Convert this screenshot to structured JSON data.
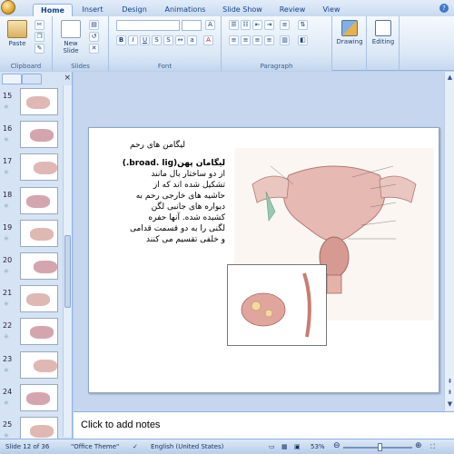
{
  "ribbon": {
    "tabs": [
      "Home",
      "Insert",
      "Design",
      "Animations",
      "Slide Show",
      "Review",
      "View"
    ],
    "active_tab": "Home",
    "groups": {
      "clipboard": {
        "label": "Clipboard",
        "paste": "Paste"
      },
      "slides": {
        "label": "Slides",
        "new_slide": "New Slide"
      },
      "font": {
        "label": "Font"
      },
      "paragraph": {
        "label": "Paragraph"
      },
      "drawing": {
        "label": "Drawing"
      },
      "editing": {
        "label": "Editing"
      }
    }
  },
  "thumbnails": [
    "15",
    "16",
    "17",
    "18",
    "19",
    "20",
    "21",
    "22",
    "23",
    "24",
    "25"
  ],
  "slide": {
    "title": "لیگامن های رحم",
    "body_lines": [
      "لیگامان پهن(broad. lig.)",
      "از دو ساختار بال مانند",
      "تشکیل شده اند که از",
      "حاشیه های خارجی رحم به",
      "دیواره های جانبی لگن",
      "کشیده شده. آنها حفره",
      "لگنی را به دو قسمت قدامی",
      "و خلفی تقسیم می کنند"
    ]
  },
  "notes_placeholder": "Click to add notes",
  "status": {
    "slide_info": "Slide 12 of 36",
    "theme": "\"Office Theme\"",
    "language": "English (United States)",
    "zoom": "53%",
    "zoom_fraction": 0.53
  },
  "colors": {
    "ribbon_text": "#15428b",
    "accent": "#3f78c8"
  }
}
